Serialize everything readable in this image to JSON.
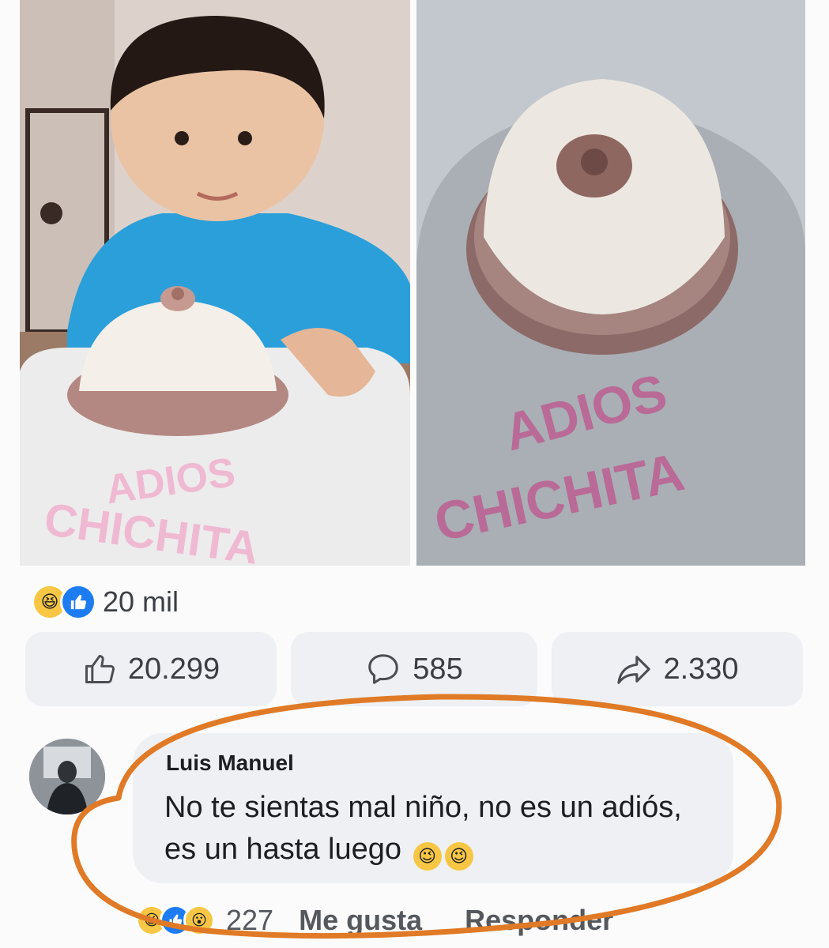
{
  "post": {
    "images": [
      {
        "cake_text_line1": "ADIOS",
        "cake_text_line2": "CHICHITA"
      },
      {
        "cake_text_line1": "ADIOS",
        "cake_text_line2": "CHICHITA"
      }
    ],
    "reactions": {
      "icons": [
        "haha-icon",
        "like-icon"
      ],
      "count": "20 mil"
    },
    "actions": {
      "like": {
        "icon": "thumbs-up-icon",
        "count": "20.299"
      },
      "comment": {
        "icon": "comment-bubble-icon",
        "count": "585"
      },
      "share": {
        "icon": "share-arrow-icon",
        "count": "2.330"
      }
    }
  },
  "comment": {
    "author": "Luis Manuel",
    "text": "No te sientas mal niño, no es un adiós, es un hasta luego",
    "emojis": [
      "wink-emoji",
      "wink-emoji"
    ],
    "reaction_icons": [
      "haha-icon",
      "like-icon",
      "wow-icon"
    ],
    "reaction_count": "227",
    "like_label": "Me gusta",
    "reply_label": "Responder"
  },
  "colors": {
    "highlight": "#e07a26",
    "like_blue": "#1d7cf2",
    "bubble": "#eef0f3"
  }
}
